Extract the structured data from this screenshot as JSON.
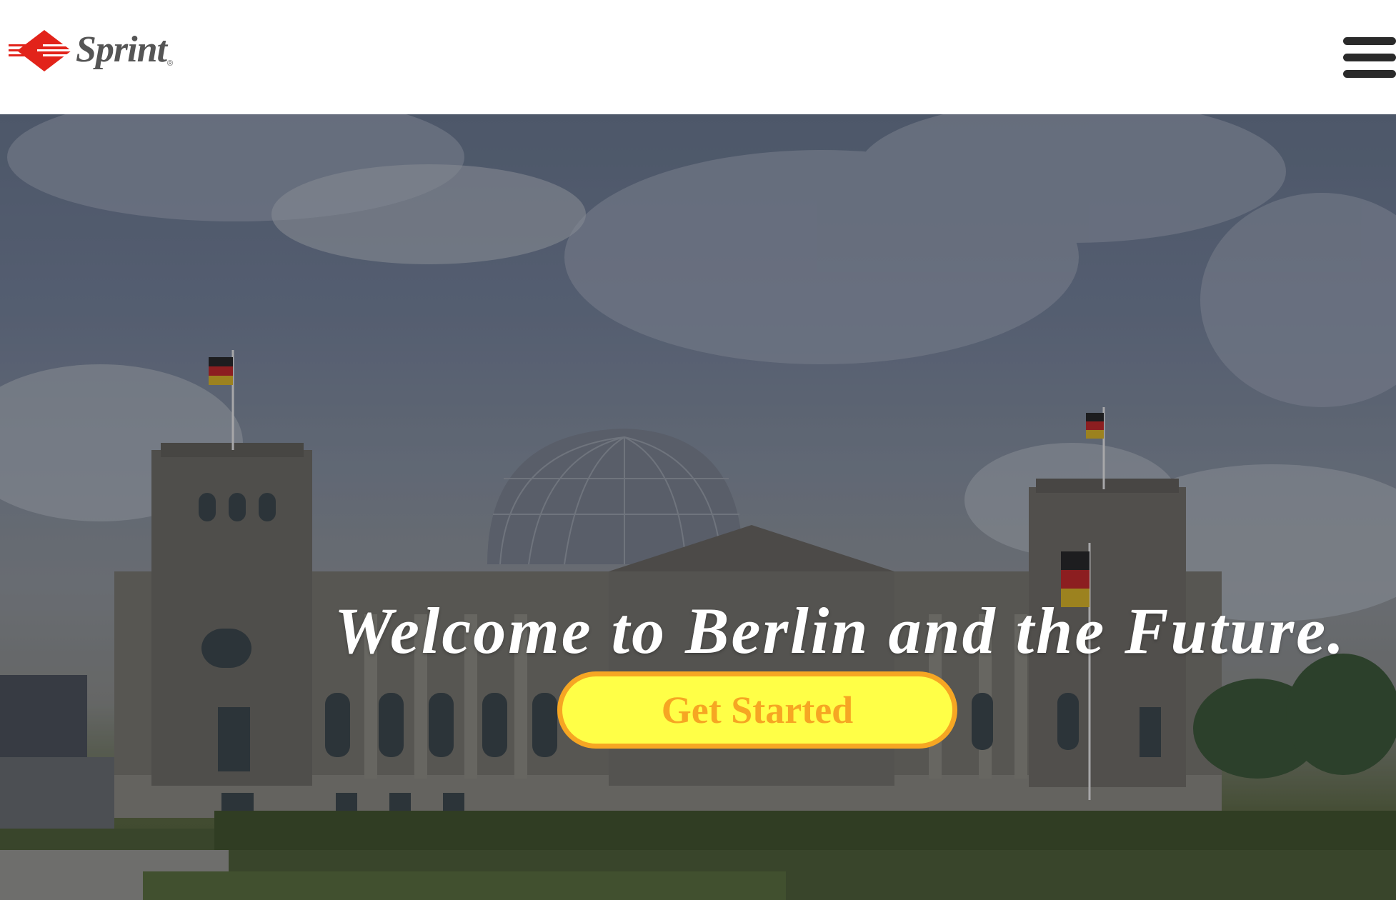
{
  "header": {
    "logo_text": "Sprint",
    "logo_registered": "®",
    "menu_icon": "hamburger-menu-icon"
  },
  "hero": {
    "background": "photo of the Reichstag building in Berlin with German flags under a cloudy sky",
    "headline": "Welcome to Berlin and the Future.",
    "cta_label": "Get Started"
  },
  "colors": {
    "logo_red": "#e2231a",
    "logo_gray": "#555555",
    "cta_fill": "#ffff47",
    "cta_border_and_text": "#f6a623",
    "headline_text": "#ffffff",
    "menu_icon": "#2a2a2a"
  }
}
